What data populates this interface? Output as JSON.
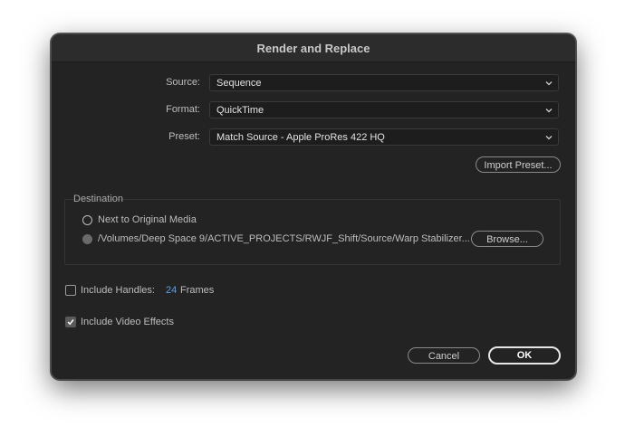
{
  "dialog": {
    "title": "Render and Replace",
    "source_label": "Source:",
    "source_value": "Sequence",
    "format_label": "Format:",
    "format_value": "QuickTime",
    "preset_label": "Preset:",
    "preset_value": "Match Source - Apple ProRes 422 HQ",
    "import_preset_label": "Import Preset...",
    "destination": {
      "title": "Destination",
      "option_original": "Next to Original Media",
      "option_path": "/Volumes/Deep Space 9/ACTIVE_PROJECTS/RWJF_Shift/Source/Warp Stabilizer...",
      "browse_label": "Browse...",
      "selected": "path"
    },
    "include_handles_label": "Include Handles:",
    "include_handles_checked": false,
    "handles_value": "24",
    "handles_unit": "Frames",
    "handles_value_color": "#5aa0e6",
    "include_video_effects_label": "Include Video Effects",
    "include_video_effects_checked": true,
    "cancel_label": "Cancel",
    "ok_label": "OK"
  },
  "icons": {
    "dropdown": "chevron-down-icon",
    "check": "checkmark-icon"
  }
}
